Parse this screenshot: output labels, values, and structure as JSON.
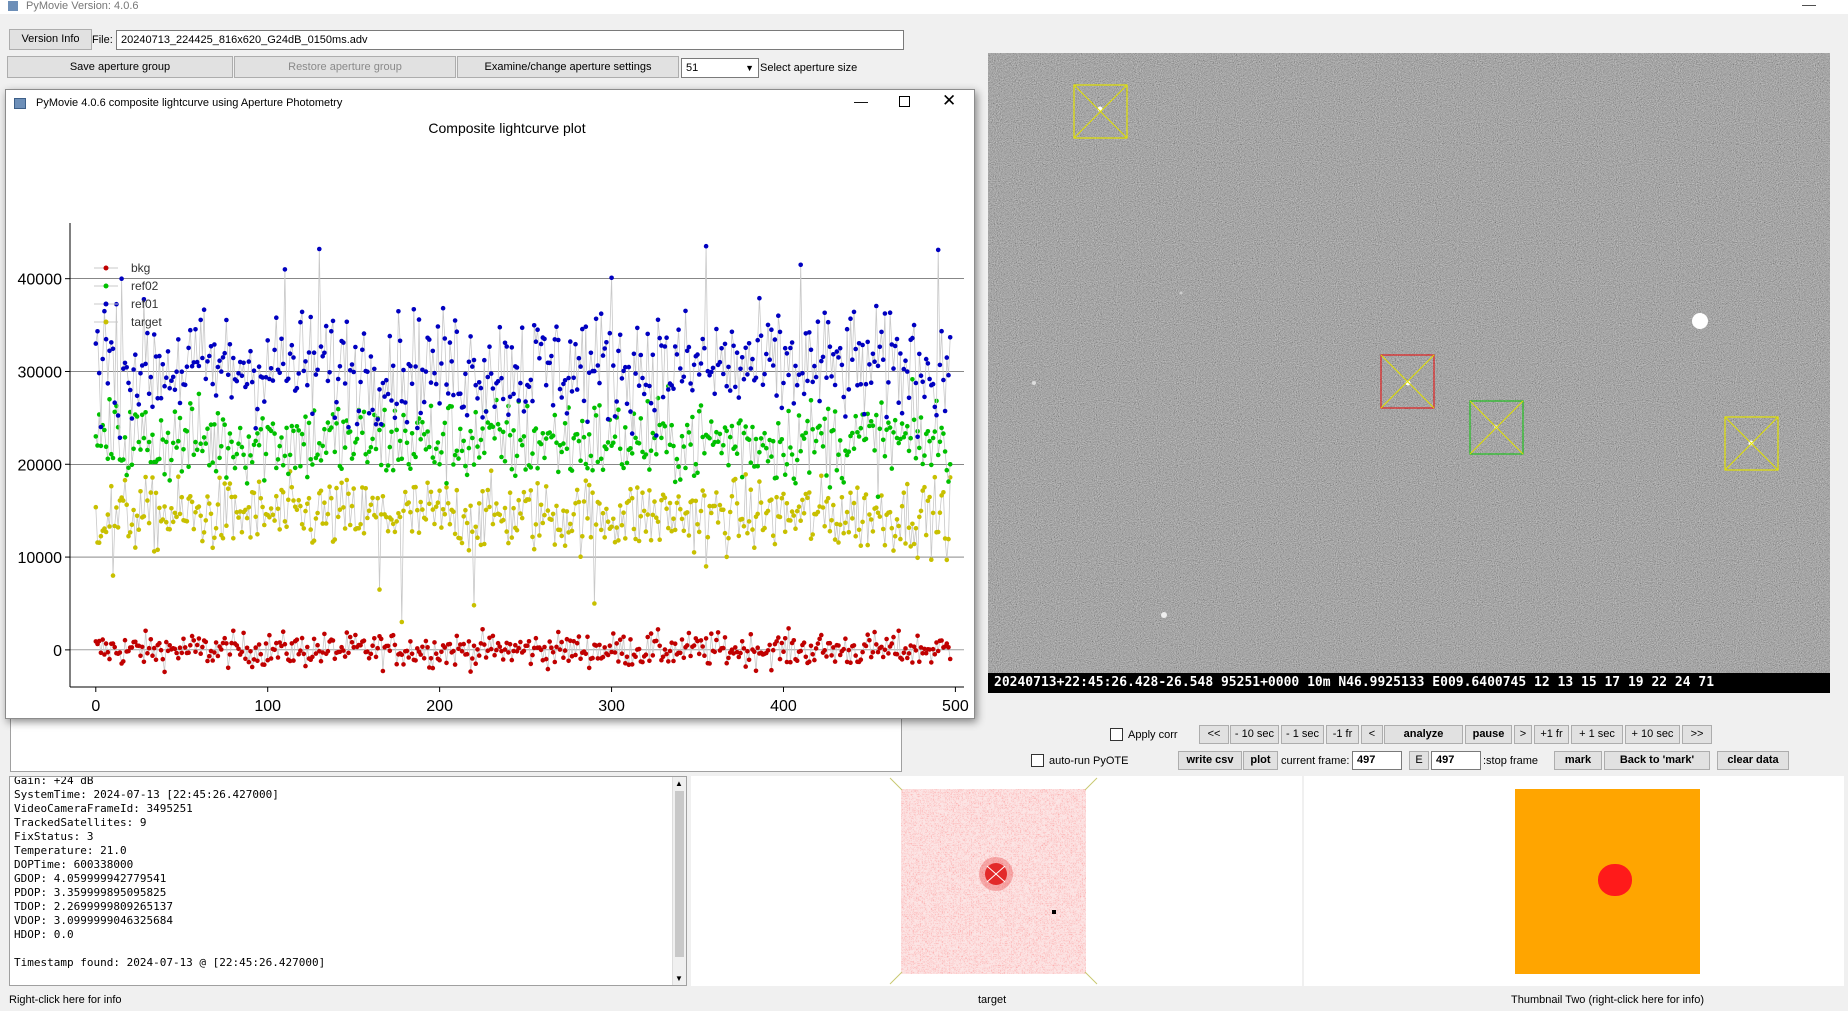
{
  "app": {
    "title": "PyMovie  Version: 4.0.6"
  },
  "toolbar": {
    "version_info": "Version Info",
    "file_label": "File:",
    "file_value": "20240713_224425_816x620_G24dB_0150ms.adv",
    "save_aperture_group": "Save aperture group",
    "restore_aperture_group": "Restore aperture group",
    "examine_aperture": "Examine/change aperture settings",
    "aperture_size_value": "51",
    "select_aperture_label": "Select aperture size"
  },
  "plot_window": {
    "title": "PyMovie 4.0.6 composite lightcurve using Aperture Photometry",
    "chart_title": "Composite lightcurve plot"
  },
  "chart_data": {
    "type": "scatter",
    "title": "Composite lightcurve plot",
    "xlabel": "",
    "ylabel": "",
    "xlim": [
      -15,
      505
    ],
    "ylim": [
      -4000,
      46000
    ],
    "x_ticks": [
      0,
      100,
      200,
      300,
      400,
      500
    ],
    "y_ticks": [
      0,
      10000,
      20000,
      30000,
      40000
    ],
    "frames": [
      0,
      497
    ],
    "grid": "horizontal",
    "legend_placement": "top-left",
    "series": [
      {
        "name": "bkg",
        "color": "#c00000",
        "mean": 0,
        "spread": 1500
      },
      {
        "name": "ref02",
        "color": "#00c000",
        "mean": 22500,
        "spread": 3800
      },
      {
        "name": "ref01",
        "color": "#0000c0",
        "mean": 30500,
        "spread": 5000
      },
      {
        "name": "target",
        "color": "#c8c000",
        "mean": 14500,
        "spread": 3200
      }
    ],
    "sample_points": {
      "ref01": [
        [
          0,
          33000
        ],
        [
          5,
          36500
        ],
        [
          15,
          40000
        ],
        [
          20,
          28000
        ],
        [
          110,
          41000
        ],
        [
          130,
          43200
        ],
        [
          300,
          40100
        ],
        [
          355,
          43500
        ],
        [
          410,
          41500
        ],
        [
          490,
          43100
        ],
        [
          495,
          31500
        ]
      ],
      "target": [
        [
          10,
          8000
        ],
        [
          165,
          6500
        ],
        [
          178,
          3000
        ],
        [
          220,
          4800
        ],
        [
          290,
          5000
        ],
        [
          355,
          9000
        ],
        [
          494,
          12000
        ]
      ],
      "ref02": [
        [
          0,
          23000
        ],
        [
          100,
          24000
        ],
        [
          200,
          20000
        ],
        [
          300,
          22000
        ],
        [
          400,
          21000
        ],
        [
          497,
          20000
        ]
      ]
    }
  },
  "video": {
    "overlay_text": "20240713+22:45:26.428-26.548 95251+0000    10m N46.9925133 E009.6400745 12  13  15  17  19  22  24  71",
    "apertures": [
      {
        "name": "yellow-top-left",
        "color": "#e0e000"
      },
      {
        "name": "target-red",
        "color": "#e02020"
      },
      {
        "name": "green",
        "color": "#20c020"
      },
      {
        "name": "yellow-right",
        "color": "#e0e000"
      }
    ]
  },
  "controls": {
    "apply_corr": "Apply corr",
    "auto_run_pyote": "auto-run PyOTE",
    "btn_back_all": "<<",
    "btn_m10s": "- 10 sec",
    "btn_m1s": "- 1 sec",
    "btn_m1fr": "-1 fr",
    "btn_prev": "<",
    "btn_analyze": "analyze",
    "btn_pause": "pause",
    "btn_next": ">",
    "btn_p1fr": "+1 fr",
    "btn_p1s": "+ 1 sec",
    "btn_p10s": "+ 10 sec",
    "btn_fwd_all": ">>",
    "btn_write_csv": "write csv",
    "btn_plot": "plot",
    "current_frame_label": "current frame:",
    "current_frame_value": "497",
    "e_label": "E",
    "stop_frame_value": "497",
    "stop_frame_label": ":stop frame",
    "btn_mark": "mark",
    "btn_back_to_mark": "Back to 'mark'",
    "btn_clear_data": "clear data"
  },
  "log": {
    "lines": [
      "Gain: +24 dB",
      "SystemTime: 2024-07-13 [22:45:26.427000]",
      "VideoCameraFrameId: 3495251",
      "TrackedSatellites: 9",
      "FixStatus: 3",
      "Temperature: 21.0",
      "DOPTime: 600338000",
      "GDOP: 4.059999942779541",
      "PDOP: 3.359999895095825",
      "TDOP: 2.2699999809265137",
      "VDOP: 3.0999999046325684",
      "HDOP: 0.0",
      "",
      "Timestamp found: 2024-07-13 @ [22:45:26.427000]"
    ]
  },
  "thumbnails": {
    "one_caption": "target",
    "two_caption": "Thumbnail Two (right-click here for info)",
    "thumb_two_bg": "#ffa500"
  },
  "status": {
    "left": "Right-click here for info"
  }
}
